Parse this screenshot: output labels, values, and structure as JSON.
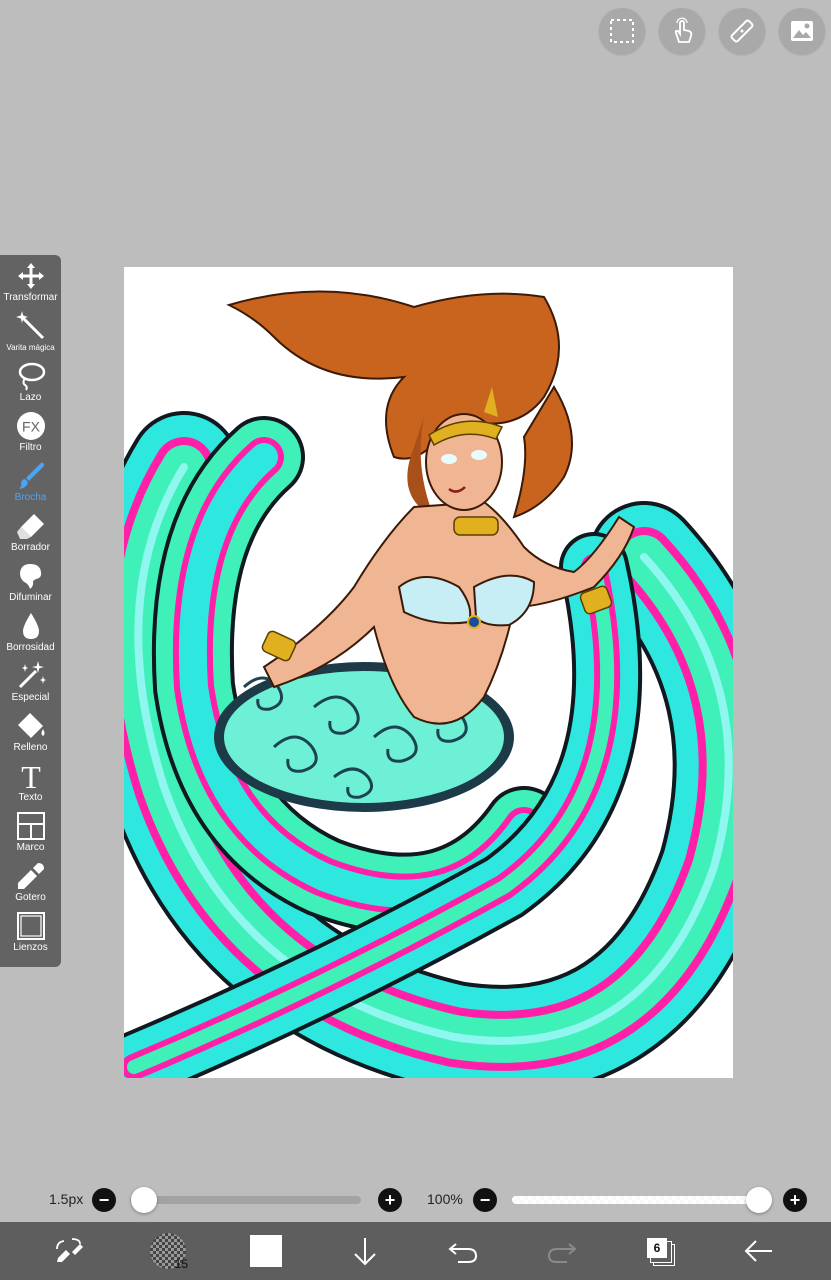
{
  "top_buttons": [
    {
      "name": "selection-icon"
    },
    {
      "name": "gesture-icon"
    },
    {
      "name": "ruler-icon"
    },
    {
      "name": "material-icon"
    }
  ],
  "toolbar": {
    "items": [
      {
        "label": "Transformar",
        "icon": "move-arrows-icon"
      },
      {
        "label": "Varita mágica",
        "icon": "magic-wand-icon"
      },
      {
        "label": "Lazo",
        "icon": "lasso-icon"
      },
      {
        "label": "Filtro",
        "icon": "fx-icon",
        "fx_text": "FX"
      },
      {
        "label": "Brocha",
        "icon": "brush-icon",
        "active": true
      },
      {
        "label": "Borrador",
        "icon": "eraser-icon"
      },
      {
        "label": "Difuminar",
        "icon": "smudge-icon"
      },
      {
        "label": "Borrosidad",
        "icon": "blur-drop-icon"
      },
      {
        "label": "Especial",
        "icon": "special-sparkle-icon"
      },
      {
        "label": "Relleno",
        "icon": "fill-bucket-icon"
      },
      {
        "label": "Texto",
        "icon": "text-t-icon",
        "glyph": "T"
      },
      {
        "label": "Marco",
        "icon": "frame-divider-icon"
      },
      {
        "label": "Gotero",
        "icon": "eyedropper-icon"
      },
      {
        "label": "Lienzos",
        "icon": "canvas-icon"
      }
    ],
    "active_color": "#4da3f5"
  },
  "brush_size": {
    "label": "1.5px",
    "minus": "−",
    "plus": "+",
    "level": 0.02
  },
  "opacity": {
    "label": "100%",
    "minus": "−",
    "plus": "+",
    "level": 1.0
  },
  "bottom_bar": {
    "brush_number": "15",
    "layer_count": "6",
    "current_color": "#ffffff"
  },
  "colors": {
    "background": "#bdbdbd",
    "toolbar": "#636363",
    "bottom_bar": "#5e5e5e",
    "artwork_cyan": "#2ee8e0",
    "artwork_mint": "#3ff0b8",
    "artwork_magenta": "#ff1fa8",
    "artwork_hair": "#c8641e"
  }
}
